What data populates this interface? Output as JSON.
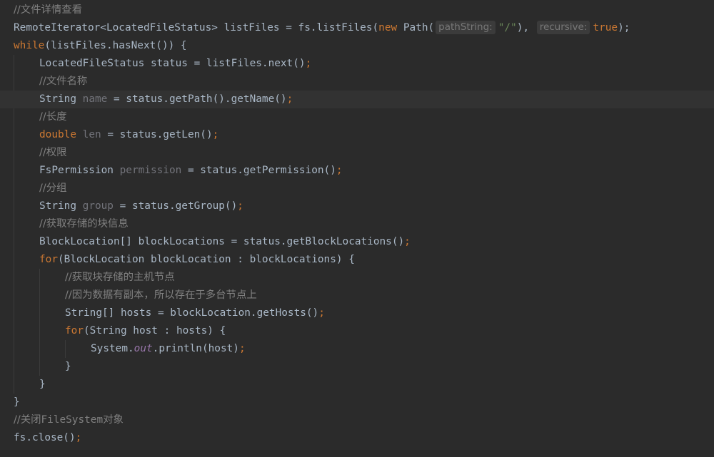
{
  "editor": {
    "lines": [
      {
        "segments": [
          {
            "t": "//文件详情查看",
            "c": "cc"
          }
        ]
      },
      {
        "segments": [
          {
            "t": "RemoteIterator<LocatedFileStatus> listFiles = fs.listFiles("
          },
          {
            "t": "new",
            "c": "k"
          },
          {
            "t": " Path("
          },
          {
            "t": "pathString:",
            "c": "hint"
          },
          {
            "t": "\"/\"",
            "c": "s"
          },
          {
            "t": "), "
          },
          {
            "t": "recursive:",
            "c": "hint"
          },
          {
            "t": "true",
            "c": "k"
          },
          {
            "t": ");"
          }
        ]
      },
      {
        "segments": [
          {
            "t": "while",
            "c": "k"
          },
          {
            "t": "(listFiles.hasNext()) {"
          }
        ]
      },
      {
        "segments": [
          {
            "t": "LocatedFileStatus status = listFiles.next()"
          },
          {
            "t": ";",
            "c": "k"
          }
        ]
      },
      {
        "segments": [
          {
            "t": "//文件名称",
            "c": "cc"
          }
        ]
      },
      {
        "current": true,
        "segments": [
          {
            "t": "String "
          },
          {
            "t": "name",
            "c": "u"
          },
          {
            "t": " = status.getPath().getName()"
          },
          {
            "t": ";",
            "c": "k"
          }
        ]
      },
      {
        "segments": [
          {
            "t": "//长度",
            "c": "cc"
          }
        ]
      },
      {
        "segments": [
          {
            "t": "double",
            "c": "k"
          },
          {
            "t": " "
          },
          {
            "t": "len",
            "c": "u"
          },
          {
            "t": " = status.getLen()"
          },
          {
            "t": ";",
            "c": "k"
          }
        ]
      },
      {
        "segments": [
          {
            "t": "//权限",
            "c": "cc"
          }
        ]
      },
      {
        "segments": [
          {
            "t": "FsPermission "
          },
          {
            "t": "permission",
            "c": "u"
          },
          {
            "t": " = status.getPermission()"
          },
          {
            "t": ";",
            "c": "k"
          }
        ]
      },
      {
        "segments": [
          {
            "t": "//分组",
            "c": "cc"
          }
        ]
      },
      {
        "segments": [
          {
            "t": "String "
          },
          {
            "t": "group",
            "c": "u"
          },
          {
            "t": " = status.getGroup()"
          },
          {
            "t": ";",
            "c": "k"
          }
        ]
      },
      {
        "segments": [
          {
            "t": "//获取存储的块信息",
            "c": "cc"
          }
        ]
      },
      {
        "segments": [
          {
            "t": "BlockLocation[] blockLocations = status.getBlockLocations()"
          },
          {
            "t": ";",
            "c": "k"
          }
        ]
      },
      {
        "segments": [
          {
            "t": "for",
            "c": "k"
          },
          {
            "t": "(BlockLocation blockLocation : blockLocations) {"
          }
        ]
      },
      {
        "segments": [
          {
            "t": "//获取块存储的主机节点",
            "c": "cc"
          }
        ]
      },
      {
        "segments": [
          {
            "t": "//因为数据有副本，所以存在于多台节点上",
            "c": "cc"
          }
        ]
      },
      {
        "segments": [
          {
            "t": "String[] hosts = blockLocation.getHosts()"
          },
          {
            "t": ";",
            "c": "k"
          }
        ]
      },
      {
        "segments": [
          {
            "t": "for",
            "c": "k"
          },
          {
            "t": "(String host : hosts) {"
          }
        ]
      },
      {
        "segments": [
          {
            "t": "System."
          },
          {
            "t": "out",
            "c": "f"
          },
          {
            "t": ".println(host)"
          },
          {
            "t": ";",
            "c": "k"
          }
        ]
      },
      {
        "segments": [
          {
            "t": "}"
          }
        ]
      },
      {
        "segments": [
          {
            "t": "}"
          }
        ]
      },
      {
        "segments": [
          {
            "t": "}"
          }
        ]
      },
      {
        "segments": [
          {
            "t": "//关闭",
            "c": "cc"
          },
          {
            "t": "FileSystem",
            "c": "c"
          },
          {
            "t": "对象",
            "c": "cc"
          }
        ]
      },
      {
        "segments": [
          {
            "t": "fs.close()"
          },
          {
            "t": ";",
            "c": "k"
          }
        ]
      }
    ]
  },
  "colors": {
    "background": "#2b2b2b",
    "current_line": "#323232",
    "text": "#a9b7c6",
    "keyword": "#cc7832",
    "string": "#6a8759",
    "comment": "#808080",
    "unused_variable": "#72737a",
    "static_field": "#9876aa",
    "inlay_hint_bg": "#3b3b3b",
    "inlay_hint_text": "#787878"
  }
}
